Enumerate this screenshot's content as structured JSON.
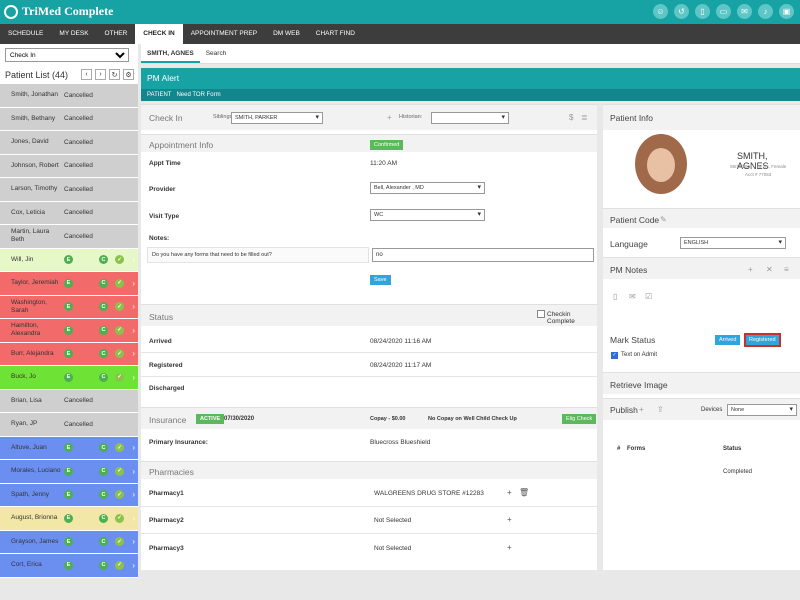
{
  "app": {
    "title": "TriMed Complete"
  },
  "nav": {
    "tabs": [
      "SCHEDULE",
      "MY DESK",
      "OTHER",
      "CHECK IN",
      "APPOINTMENT PREP",
      "DM WEB",
      "CHART FIND"
    ]
  },
  "left": {
    "select_value": "Check In",
    "list_title": "Patient List (44)",
    "patients": [
      {
        "name": "Smith, Jonathan",
        "status": "Cancelled",
        "color": "#cfcfcf"
      },
      {
        "name": "Smith, Bethany",
        "status": "Cancelled",
        "color": "#cfcfcf"
      },
      {
        "name": "Jones, David",
        "status": "Cancelled",
        "color": "#cfcfcf"
      },
      {
        "name": "Johnson, Robert",
        "status": "Cancelled",
        "color": "#cfcfcf"
      },
      {
        "name": "Larson, Timothy",
        "status": "Cancelled",
        "color": "#cfcfcf"
      },
      {
        "name": "Cox, Leticia",
        "status": "Cancelled",
        "color": "#cfcfcf"
      },
      {
        "name": "Martin, Laura Beth",
        "status": "Cancelled",
        "color": "#cfcfcf"
      },
      {
        "name": "Will, Jin",
        "status": "",
        "color": "#e6f7c8"
      },
      {
        "name": "Taylor, Jeremiah",
        "status": "",
        "color": "#f26a6a"
      },
      {
        "name": "Washington, Sarah",
        "status": "",
        "color": "#f26a6a"
      },
      {
        "name": "Hamilton, Alexandra",
        "status": "",
        "color": "#f26a6a"
      },
      {
        "name": "Burr, Alejandra",
        "status": "",
        "color": "#f26a6a"
      },
      {
        "name": "Buck, Jo",
        "status": "",
        "color": "#6ee336"
      },
      {
        "name": "Brian, Lisa",
        "status": "Cancelled",
        "color": "#cfcfcf"
      },
      {
        "name": "Ryan, JP",
        "status": "Cancelled",
        "color": "#cfcfcf"
      },
      {
        "name": "Altuve, Juan",
        "status": "",
        "color": "#6b8ff0"
      },
      {
        "name": "Morales, Luciano",
        "status": "",
        "color": "#6b8ff0"
      },
      {
        "name": "Spath, Jenny",
        "status": "",
        "color": "#6b8ff0"
      },
      {
        "name": "August, Brionna",
        "status": "",
        "color": "#f3e7a8"
      },
      {
        "name": "Grayson, James",
        "status": "",
        "color": "#6b8ff0"
      },
      {
        "name": "Cort, Erica",
        "status": "",
        "color": "#6b8ff0"
      }
    ]
  },
  "subtabs": {
    "patient": "SMITH, AGNES",
    "search": "Search"
  },
  "alert": {
    "title": "PM Alert",
    "label": "PATIENT",
    "text": "Need TOR Form"
  },
  "checkin": {
    "title": "Check In",
    "siblings_label": "Siblings:",
    "siblings_value": "SMITH, PARKER",
    "historian_label": "Historian:",
    "dollar_icon": "dollar-icon"
  },
  "appointment": {
    "title": "Appointment Info",
    "badge": "Confirmed",
    "appt_time_label": "Appt Time",
    "appt_time": "11:20 AM",
    "provider_label": "Provider",
    "provider": "Bell, Alexander , MD",
    "visit_type_label": "Visit Type",
    "visit_type": "WC",
    "notes_label": "Notes:",
    "question": "Do you have any forms that need to be filled out?",
    "answer": "no",
    "save": "Save"
  },
  "status": {
    "title": "Status",
    "checkin_complete": "Checkin Complete",
    "arrived_label": "Arrived",
    "arrived": "08/24/2020 11:16 AM",
    "registered_label": "Registered",
    "registered": "08/24/2020 11:17 AM",
    "discharged_label": "Discharged"
  },
  "insurance": {
    "title": "Insurance",
    "badge": "ACTIVE",
    "date": "07/30/2020",
    "copay": "Copay - $0.00",
    "note": "No Copay on Well Child Check Up",
    "elig": "Elig Check",
    "primary_label": "Primary Insurance:",
    "primary": "Bluecross Blueshield"
  },
  "pharmacies": {
    "title": "Pharmacies",
    "items": [
      {
        "label": "Pharmacy1",
        "value": "WALGREENS DRUG STORE #12283"
      },
      {
        "label": "Pharmacy2",
        "value": "Not Selected"
      },
      {
        "label": "Pharmacy3",
        "value": "Not Selected"
      }
    ]
  },
  "right": {
    "patient_info": "Patient Info",
    "name": "SMITH, AGNES",
    "details1": "08/10/2001 · 19 yrs, Female",
    "details2": "Acct # 77053",
    "patient_code": "Patient Code",
    "language_label": "Language",
    "language": "ENGLISH",
    "pm_notes": "PM Notes",
    "mark_status": "Mark Status",
    "arrived_btn": "Arrived",
    "registered_btn": "Registered",
    "text_on_admit": "Text on Admit",
    "retrieve_image": "Retrieve Image",
    "publish": "Publish",
    "devices_label": "Devices",
    "devices": "None",
    "forms_hash": "#",
    "forms_col": "Forms",
    "status_col": "Status",
    "form_status": "Completed"
  }
}
